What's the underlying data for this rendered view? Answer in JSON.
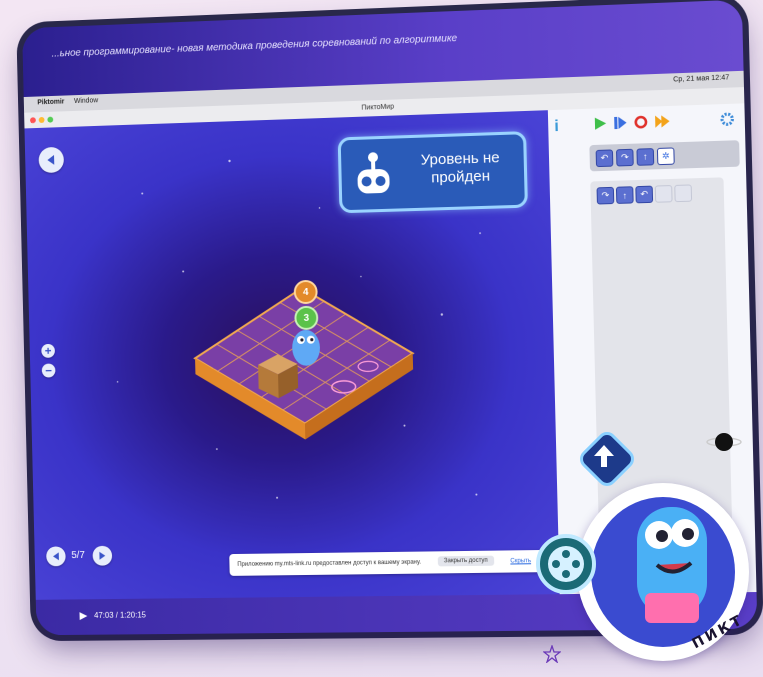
{
  "video": {
    "title": "...ьное программирование- новая методика проведения соревнований по алгоритмике",
    "time": "47:03 / 1:20:15"
  },
  "menubar": {
    "app": "Piktomir",
    "window": "Window",
    "clock": "Ср, 21 мая 12:47"
  },
  "window_title": "ПиктоМир",
  "status": {
    "line1": "Уровень не",
    "line2": "пройден"
  },
  "level": {
    "counter": "5/7"
  },
  "robot_badges": {
    "step_top": "4",
    "step_bottom": "3"
  },
  "share_banner": {
    "message": "Приложению my.mts-link.ru предоставлен доступ к вашему экрану.",
    "stop_button": "Закрыть доступ",
    "hide_link": "Скрыть"
  },
  "logo_text": "ПИКТ",
  "colors": {
    "panel_bg": "#f5f6fb",
    "game_bg": "#3a33c8",
    "cmd_tile": "#5b6fd0",
    "header_purple": "#3a2fb0"
  },
  "icons": [
    "back-arrow-icon",
    "robot-icon",
    "info-icon",
    "play-icon",
    "step-icon",
    "stop-icon",
    "fast-forward-icon",
    "settings-icon",
    "turn-left-icon",
    "turn-right-icon",
    "forward-icon",
    "light-icon",
    "zoom-in-icon",
    "zoom-out-icon",
    "prev-icon",
    "next-icon",
    "star-icon",
    "planet-icon",
    "film-reel-icon"
  ]
}
